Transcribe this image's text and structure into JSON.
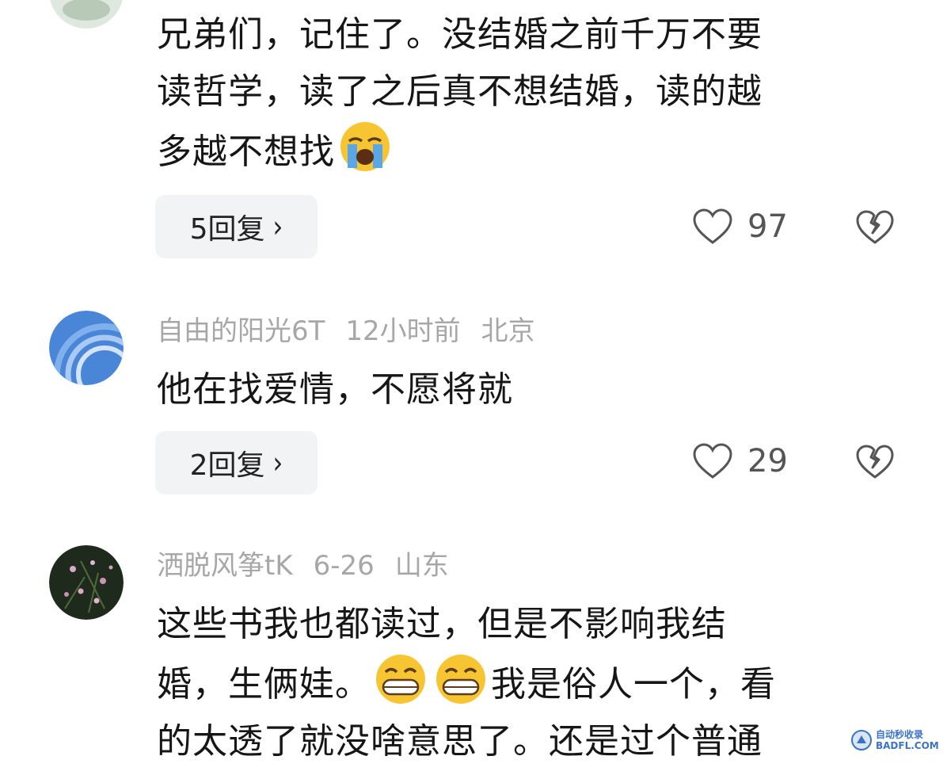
{
  "comments": [
    {
      "meta": {
        "user": "",
        "time": "",
        "location": ""
      },
      "text_lines": [
        "兄弟们，记住了。没结婚之前千万不要",
        "读哲学，读了之后真不想结婚，读的越",
        "多越不想找"
      ],
      "emoji": "loudly-crying-face",
      "reply_label": "5回复",
      "likes": "97"
    },
    {
      "meta": {
        "user": "自由的阳光6T",
        "time": "12小时前",
        "location": "北京"
      },
      "text_lines": [
        "他在找爱情，不愿将就"
      ],
      "reply_label": "2回复",
      "likes": "29"
    },
    {
      "meta": {
        "user": "洒脱风筝tK",
        "time": "6-26",
        "location": "山东"
      },
      "line1": "这些书我也都读过，但是不影响我结",
      "line2_a": "婚，生俩娃。",
      "line2_b": "我是俗人一个，看",
      "line3": "的太透了就没啥意思了。还是过个普通",
      "emoji": "grinning-face"
    }
  ],
  "watermark": {
    "line1": "自动秒收录",
    "line2": "BADFL.COM"
  }
}
